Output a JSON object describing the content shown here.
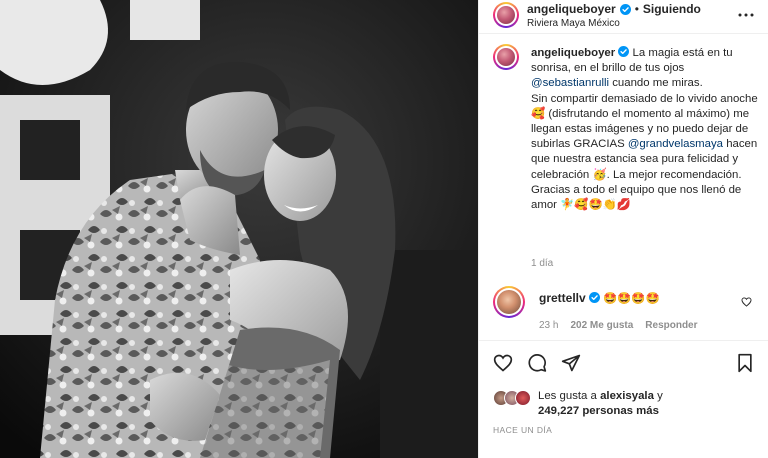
{
  "header": {
    "username": "angeliqueboyer",
    "separator": "•",
    "follow_status": "Siguiendo",
    "location": "Riviera Maya México"
  },
  "caption": {
    "username": "angeliqueboyer",
    "p1_a": "La magia está en tu sonrisa, en el brillo de tus ojos",
    "p1_mention": "@sebastianrulli",
    "p1_b": "cuando me miras.",
    "p2_a": "Sin compartir demasiado de lo vivido anoche",
    "p2_emoji": "🥰",
    "p2_b": "(disfrutando el momento al máximo) me llegan estas imágenes y no puedo dejar de subirlas GRACIAS",
    "p2_mention": "@grandvelasmaya",
    "p2_c": "hacen que nuestra estancia sea pura felicidad y celebración",
    "p2_emoji2": "🥳",
    "p2_d": ". La mejor recomendación.",
    "p3_a": "Gracias a todo el equipo que nos llenó de amor",
    "p3_emojis": "🧚🥰🤩👏💋",
    "time": "1 día"
  },
  "comment": {
    "username": "grettellv",
    "text": "🤩🤩🤩🤩",
    "time": "23 h",
    "likes": "202 Me gusta",
    "reply": "Responder"
  },
  "likes": {
    "prefix": "Les gusta a",
    "user": "alexisyala",
    "joiner": "y",
    "count": "249,227 personas más"
  },
  "post_time": "HACE UN DÍA",
  "icons": {
    "verified": "verified-badge-icon",
    "more": "more-options-icon",
    "heart": "heart-icon",
    "comment": "comment-icon",
    "share": "paper-plane-icon",
    "save": "bookmark-icon"
  },
  "colors": {
    "verified": "#0095f6",
    "mention": "#00376b",
    "muted": "#8e8e8e",
    "text": "#262626"
  }
}
